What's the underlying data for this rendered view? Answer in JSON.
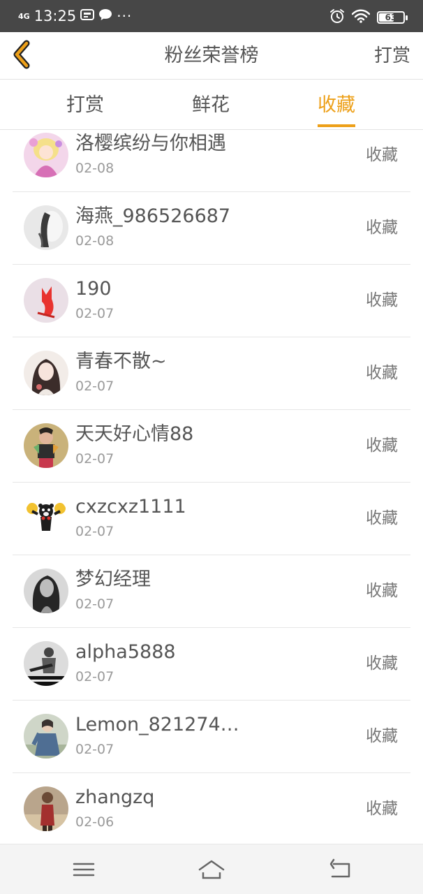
{
  "status_bar": {
    "network": "4G",
    "time": "13:25",
    "dots": "···",
    "battery": "63",
    "battery_level": 0.63
  },
  "header": {
    "title": "粉丝荣誉榜",
    "action": "打赏",
    "back_icon": "chevron-left-icon"
  },
  "tabs": [
    {
      "label": "打赏",
      "active": false
    },
    {
      "label": "鲜花",
      "active": false
    },
    {
      "label": "收藏",
      "active": true
    }
  ],
  "colors": {
    "accent": "#eda019",
    "status_bar": "#474747"
  },
  "fans": [
    {
      "name": "洛樱缤纷与你相遇",
      "date": "02-08",
      "action": "收藏",
      "avatar": "anime-girl"
    },
    {
      "name": "海燕_986526687",
      "date": "02-08",
      "action": "收藏",
      "avatar": "bw-portrait"
    },
    {
      "name": "190",
      "date": "02-07",
      "action": "收藏",
      "avatar": "red-fox-origami"
    },
    {
      "name": "青春不散~",
      "date": "02-07",
      "action": "收藏",
      "avatar": "illustrated-girl"
    },
    {
      "name": "天天好心情88",
      "date": "02-07",
      "action": "收藏",
      "avatar": "girl-photo"
    },
    {
      "name": "cxzcxz1111",
      "date": "02-07",
      "action": "收藏",
      "avatar": "kumamon-bear"
    },
    {
      "name": "梦幻经理",
      "date": "02-07",
      "action": "收藏",
      "avatar": "dark-hair-woman"
    },
    {
      "name": "alpha5888",
      "date": "02-07",
      "action": "收藏",
      "avatar": "guitar-bw"
    },
    {
      "name": "Lemon_821274…",
      "date": "02-07",
      "action": "收藏",
      "avatar": "denim-girl"
    },
    {
      "name": "zhangzq",
      "date": "02-06",
      "action": "收藏",
      "avatar": "child-beach"
    }
  ],
  "bottom_nav": [
    "menu-icon",
    "home-icon",
    "back-icon"
  ]
}
